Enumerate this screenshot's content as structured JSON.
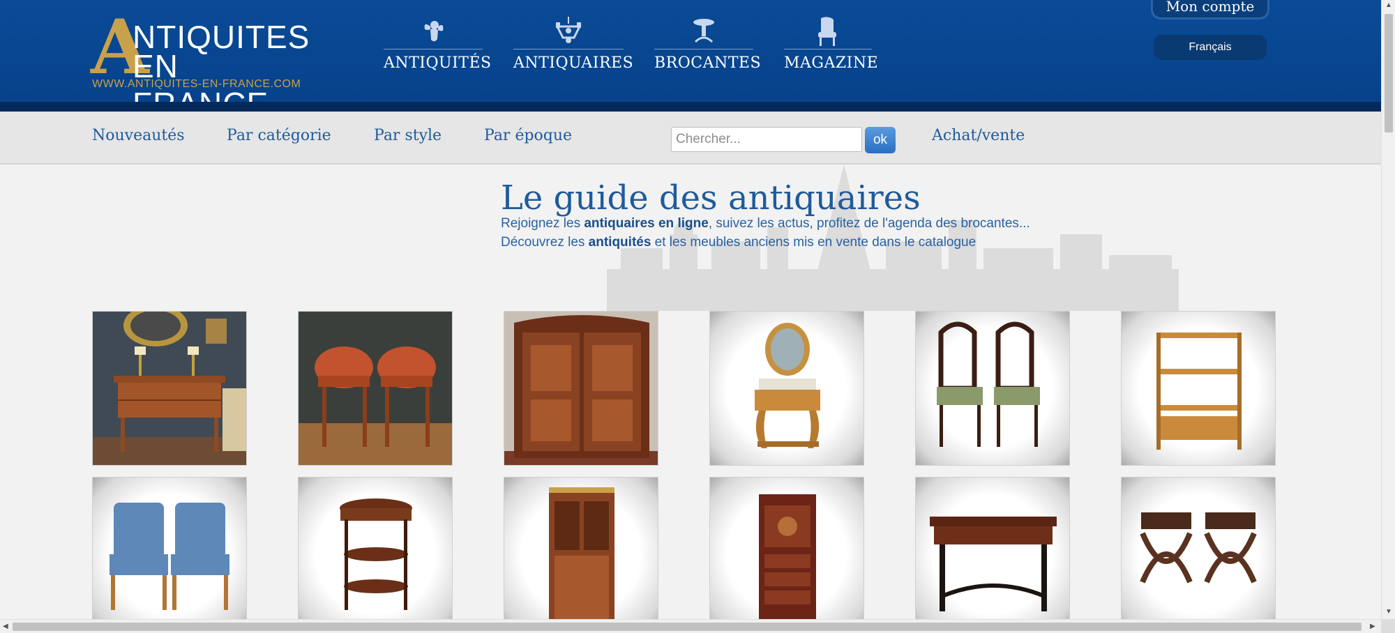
{
  "logo": {
    "letter": "A",
    "line1": "NTIQUITES",
    "line2": "EN FRANCE",
    "url": "WWW.ANTIQUITES-EN-FRANCE.COM"
  },
  "main_nav": [
    {
      "label": "ANTIQUITÉS",
      "icon": "cherub-icon"
    },
    {
      "label": "ANTIQUAIRES",
      "icon": "chandelier-icon"
    },
    {
      "label": "BROCANTES",
      "icon": "pedestal-table-icon"
    },
    {
      "label": "MAGAZINE",
      "icon": "armchair-icon"
    }
  ],
  "account": {
    "label": "Mon compte"
  },
  "language": {
    "label": "Français"
  },
  "sub_nav": [
    {
      "label": "Nouveautés"
    },
    {
      "label": "Par catégorie"
    },
    {
      "label": "Par style"
    },
    {
      "label": "Par époque"
    },
    {
      "label": "Achat/vente"
    }
  ],
  "search": {
    "placeholder": "Chercher...",
    "value": "",
    "button": "ok"
  },
  "guide": {
    "title": "Le guide des antiquaires",
    "line1_pre": "Rejoignez les ",
    "line1_bold": "antiquaires en ligne",
    "line1_post": ", suivez les actus, profitez de l'agenda des brocantes...",
    "line2_pre": "Découvrez les ",
    "line2_bold": "antiquités",
    "line2_post": " et les meubles anciens mis en vente dans le catalogue"
  },
  "products": [
    {
      "name": "console-table-with-lamps"
    },
    {
      "name": "pair-of-stools"
    },
    {
      "name": "carved-armoire"
    },
    {
      "name": "dressing-table-mirror"
    },
    {
      "name": "pair-of-chairs"
    },
    {
      "name": "shelf-etagere"
    },
    {
      "name": "pair-of-blue-armchairs"
    },
    {
      "name": "oval-side-table"
    },
    {
      "name": "bookcase-cabinet"
    },
    {
      "name": "marquetry-secretaire"
    },
    {
      "name": "writing-table"
    },
    {
      "name": "pair-of-curule-chairs"
    }
  ],
  "colors": {
    "header_blue": "#06428a",
    "link_blue": "#1e5a9c",
    "logo_gold": "#c9a14a",
    "subnav_bg": "#e6e6e6"
  }
}
